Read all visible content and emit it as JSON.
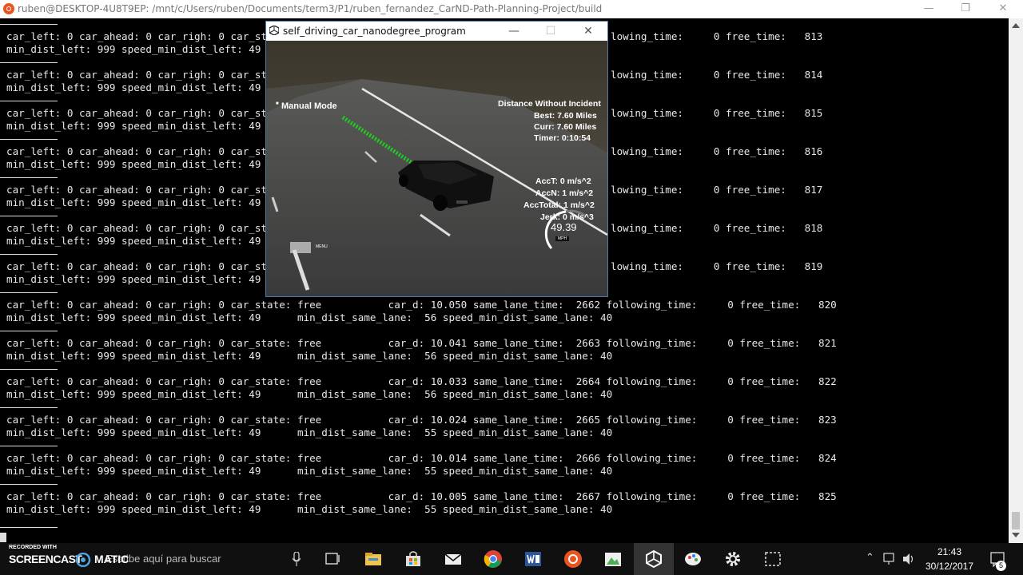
{
  "terminal": {
    "title": "ruben@DESKTOP-4U8T9EP: /mnt/c/Users/ruben/Documents/term3/P1/ruben_fernandez_CarND-Path-Planning-Project/build",
    "hidden_blocks": [
      {
        "l1a": "car_left: 0 car_ahead: 0 car_righ: 0 car_stat",
        "l1b": "lowing_time:     0 free_time:   813",
        "l2": "min_dist_left: 999 speed_min_dist_left: 49"
      },
      {
        "l1a": "car_left: 0 car_ahead: 0 car_righ: 0 car_stat",
        "l1b": "lowing_time:     0 free_time:   814",
        "l2": "min_dist_left: 999 speed_min_dist_left: 49"
      },
      {
        "l1a": "car_left: 0 car_ahead: 0 car_righ: 0 car_stat",
        "l1b": "lowing_time:     0 free_time:   815",
        "l2": "min_dist_left: 999 speed_min_dist_left: 49"
      },
      {
        "l1a": "car_left: 0 car_ahead: 0 car_righ: 0 car_stat",
        "l1b": "lowing_time:     0 free_time:   816",
        "l2": "min_dist_left: 999 speed_min_dist_left: 49"
      },
      {
        "l1a": "car_left: 0 car_ahead: 0 car_righ: 0 car_stat",
        "l1b": "lowing_time:     0 free_time:   817",
        "l2": "min_dist_left: 999 speed_min_dist_left: 49"
      },
      {
        "l1a": "car_left: 0 car_ahead: 0 car_righ: 0 car_stat",
        "l1b": "lowing_time:     0 free_time:   818",
        "l2": "min_dist_left: 999 speed_min_dist_left: 49"
      },
      {
        "l1a": "car_left: 0 car_ahead: 0 car_righ: 0 car_stat",
        "l1b": "lowing_time:     0 free_time:   819",
        "l2": "min_dist_left: 999 speed_min_dist_left: 49"
      }
    ],
    "full_blocks": [
      {
        "l1": "car_left: 0 car_ahead: 0 car_righ: 0 car_state: free           car_d: 10.050 same_lane_time:  2662 following_time:     0 free_time:   820",
        "l2": "min_dist_left: 999 speed_min_dist_left: 49      min_dist_same_lane:  56 speed_min_dist_same_lane: 40"
      },
      {
        "l1": "car_left: 0 car_ahead: 0 car_righ: 0 car_state: free           car_d: 10.041 same_lane_time:  2663 following_time:     0 free_time:   821",
        "l2": "min_dist_left: 999 speed_min_dist_left: 49      min_dist_same_lane:  56 speed_min_dist_same_lane: 40"
      },
      {
        "l1": "car_left: 0 car_ahead: 0 car_righ: 0 car_state: free           car_d: 10.033 same_lane_time:  2664 following_time:     0 free_time:   822",
        "l2": "min_dist_left: 999 speed_min_dist_left: 49      min_dist_same_lane:  56 speed_min_dist_same_lane: 40"
      },
      {
        "l1": "car_left: 0 car_ahead: 0 car_righ: 0 car_state: free           car_d: 10.024 same_lane_time:  2665 following_time:     0 free_time:   823",
        "l2": "min_dist_left: 999 speed_min_dist_left: 49      min_dist_same_lane:  55 speed_min_dist_same_lane: 40"
      },
      {
        "l1": "car_left: 0 car_ahead: 0 car_righ: 0 car_state: free           car_d: 10.014 same_lane_time:  2666 following_time:     0 free_time:   824",
        "l2": "min_dist_left: 999 speed_min_dist_left: 49      min_dist_same_lane:  55 speed_min_dist_same_lane: 40"
      },
      {
        "l1": "car_left: 0 car_ahead: 0 car_righ: 0 car_state: free           car_d: 10.005 same_lane_time:  2667 following_time:     0 free_time:   825",
        "l2": "min_dist_left: 999 speed_min_dist_left: 49      min_dist_same_lane:  55 speed_min_dist_same_lane: 40"
      }
    ]
  },
  "simulator": {
    "title": "self_driving_car_nanodegree_program",
    "mode": "Manual Mode",
    "distance_header": "Distance Without Incident",
    "best": "Best: 7.60 Miles",
    "curr": "Curr: 7.60 Miles",
    "timer": "Timer: 0:10:54",
    "acc_t": "AccT: 0 m/s^2",
    "acc_n": "AccN: 1 m/s^2",
    "acc_total": "AccTotal: 1 m/s^2",
    "jerk": "Jerk: 0 m/s^3",
    "speed": "49.39",
    "speed_unit": "MPH",
    "menu": "MENU"
  },
  "taskbar": {
    "search_placeholder": "Escribe aquí para buscar",
    "time": "21:43",
    "date": "30/12/2017",
    "notification_count": "5"
  },
  "watermark": {
    "line1": "RECORDED WITH",
    "line2": "SCREENCAST",
    "line3": "MATIC"
  }
}
